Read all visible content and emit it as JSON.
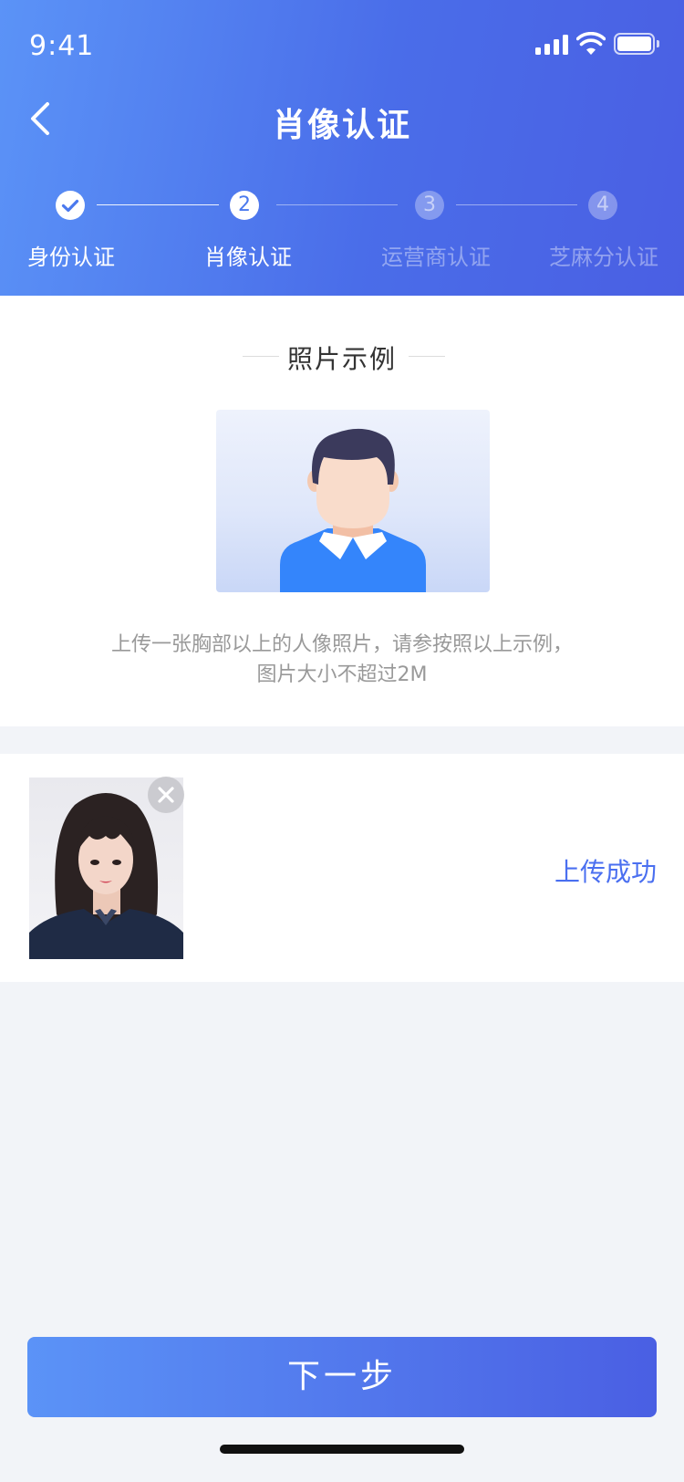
{
  "status_bar": {
    "time": "9:41"
  },
  "nav": {
    "title": "肖像认证"
  },
  "steps": [
    {
      "number": "1",
      "label": "身份认证",
      "state": "done"
    },
    {
      "number": "2",
      "label": "肖像认证",
      "state": "active"
    },
    {
      "number": "3",
      "label": "运营商认证",
      "state": "pending"
    },
    {
      "number": "4",
      "label": "芝麻分认证",
      "state": "pending"
    }
  ],
  "example": {
    "title": "照片示例",
    "hint_line1": "上传一张胸部以上的人像照片，请参按照以上示例，",
    "hint_line2": "图片大小不超过2M"
  },
  "upload": {
    "status": "上传成功"
  },
  "next_button": {
    "label": "下一步"
  },
  "colors": {
    "accent": "#4a6ff0",
    "gradient_start": "#5b93f7",
    "gradient_end": "#4a5fe3",
    "page_bg": "#f2f4f8"
  }
}
